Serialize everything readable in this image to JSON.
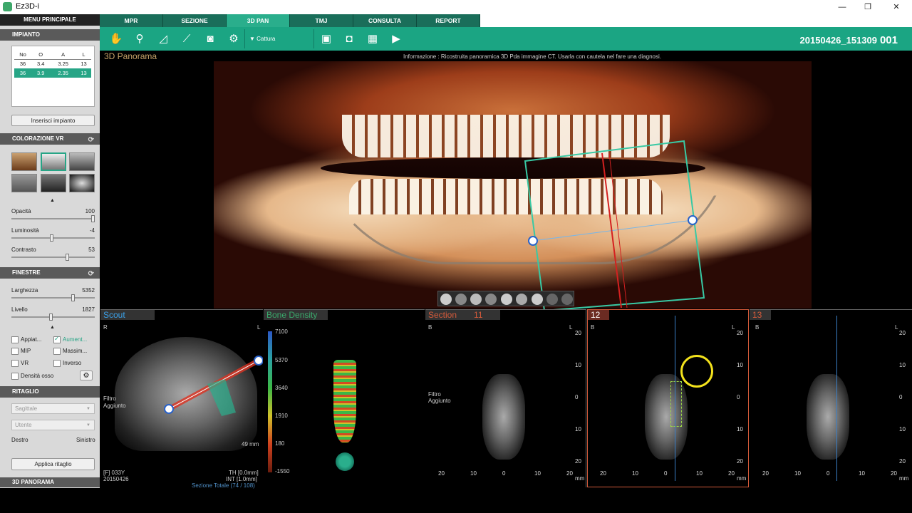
{
  "window": {
    "title": "Ez3D-i",
    "minimize": "—",
    "maximize": "❐",
    "close": "✕"
  },
  "left_panel": {
    "main_menu": "MENU PRINCIPALE",
    "implant": {
      "header": "IMPIANTO",
      "columns": [
        "No",
        "O",
        "A",
        "L"
      ],
      "rows": [
        [
          "36",
          "3.4",
          "3.25",
          "13"
        ],
        [
          "36",
          "3.9",
          "2.35",
          "13"
        ]
      ],
      "insert_button": "Inserisci impianto"
    },
    "vr": {
      "header": "COLORAZIONE VR",
      "sliders": [
        {
          "label": "Opacità",
          "value": "100",
          "fraction": 1.0
        },
        {
          "label": "Luminosità",
          "value": "-4",
          "fraction": 0.48
        },
        {
          "label": "Contrasto",
          "value": "53",
          "fraction": 0.68
        }
      ]
    },
    "windows": {
      "header": "FINESTRE",
      "sliders": [
        {
          "label": "Larghezza",
          "value": "5352",
          "fraction": 0.75
        },
        {
          "label": "Livello",
          "value": "1827",
          "fraction": 0.47
        }
      ],
      "checks": [
        {
          "label": "Appiat...",
          "on": false
        },
        {
          "label": "Aument...",
          "on": true
        },
        {
          "label": "MIP",
          "on": false
        },
        {
          "label": "Massim...",
          "on": false
        },
        {
          "label": "VR",
          "on": false
        },
        {
          "label": "Inverso",
          "on": false
        },
        {
          "label": "Densità osso",
          "on": false
        }
      ]
    },
    "crop": {
      "header": "RITAGLIO",
      "view_select": "Sagittale",
      "user_select": "Utente",
      "right_label": "Destro",
      "left_label": "Sinistro",
      "apply_button": "Applica ritaglio"
    },
    "panorama_header": "3D PANORAMA"
  },
  "tabs": [
    "MPR",
    "SEZIONE",
    "3D PAN",
    "TMJ",
    "CONSULTA",
    "REPORT"
  ],
  "toolbar": {
    "capture_label": "Cattura",
    "study_code": "20150426_151309",
    "study_num": "001"
  },
  "viewer3d": {
    "title": "3D Panorama",
    "info": "Informazione : Ricostruita panoramica 3D Pda immagine CT. Usarla con cautela nel fare una diagnosi."
  },
  "scout": {
    "title": "Scout",
    "r": "R",
    "l": "L",
    "filter": "Filtro",
    "added": "Aggiunto",
    "distance": "49 mm",
    "patient": "[F] 033Y",
    "date": "20150426",
    "th": "TH [0.0mm]",
    "int": "INT [1.0mm]",
    "total": "Sezione Totale (74 / 108)"
  },
  "bone_density": {
    "title": "Bone Density",
    "scale": [
      "7100",
      "5370",
      "3640",
      "1910",
      "180",
      "-1550"
    ]
  },
  "sections": [
    {
      "title": "Section",
      "num": "11",
      "b": "B",
      "l": "L",
      "filter": "Filtro",
      "added": "Aggiunto"
    },
    {
      "num": "12",
      "b": "B",
      "l": "L"
    },
    {
      "num": "13",
      "b": "B",
      "l": "L"
    }
  ],
  "axes": {
    "y": [
      "20",
      "10",
      "0",
      "10",
      "20"
    ],
    "x": [
      "20",
      "10",
      "0",
      "10",
      "20"
    ],
    "unit": "mm"
  },
  "colors": {
    "accent": "#1ba583",
    "tab": "#1a6e5a",
    "active_tab": "#2aae8c",
    "highlight": "#f3e21c"
  }
}
